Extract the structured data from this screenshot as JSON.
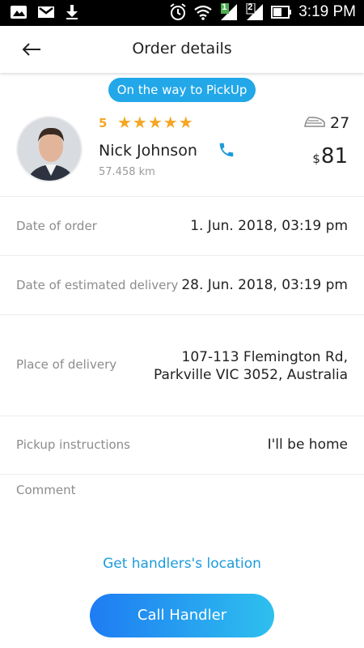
{
  "status_bar": {
    "time": "3:19 PM",
    "signal_badge_1": "1",
    "signal_badge_2": "2"
  },
  "header": {
    "title": "Order details"
  },
  "order": {
    "status": "On the way to PickUp",
    "handler": {
      "rating": "5",
      "stars": "★★★★★",
      "star_count": 5,
      "name": "Nick Johnson",
      "distance": "57.458 km",
      "iron_count": "27",
      "price_currency": "$",
      "price_amount": "81"
    },
    "details": {
      "date_of_order": {
        "label": "Date of order",
        "value": "1. Jun. 2018, 03:19 pm"
      },
      "estimated_delivery": {
        "label": "Date of estimated delivery",
        "value": "28. Jun. 2018, 03:19 pm"
      },
      "place_of_delivery": {
        "label": "Place of delivery",
        "line1": "107-113 Flemington Rd,",
        "line2": "Parkville VIC 3052, Australia"
      },
      "pickup_instructions": {
        "label": "Pickup instructions",
        "value": "I'll be home"
      },
      "comment": {
        "label": "Comment",
        "value": ""
      }
    }
  },
  "actions": {
    "location_link": "Get handlers's location",
    "call_button": "Call Handler"
  },
  "colors": {
    "accent": "#22a7e8",
    "star": "#f5a623",
    "link": "#1c9bdc",
    "button_gradient_start": "#1e7cf2",
    "button_gradient_end": "#2ec0ee"
  },
  "icons": {
    "back": "back-arrow-icon",
    "phone": "phone-icon",
    "iron": "iron-icon",
    "gallery": "gallery-icon",
    "gmail": "gmail-icon",
    "download": "download-icon",
    "alarm": "alarm-icon",
    "wifi": "wifi-icon",
    "battery": "battery-icon"
  }
}
